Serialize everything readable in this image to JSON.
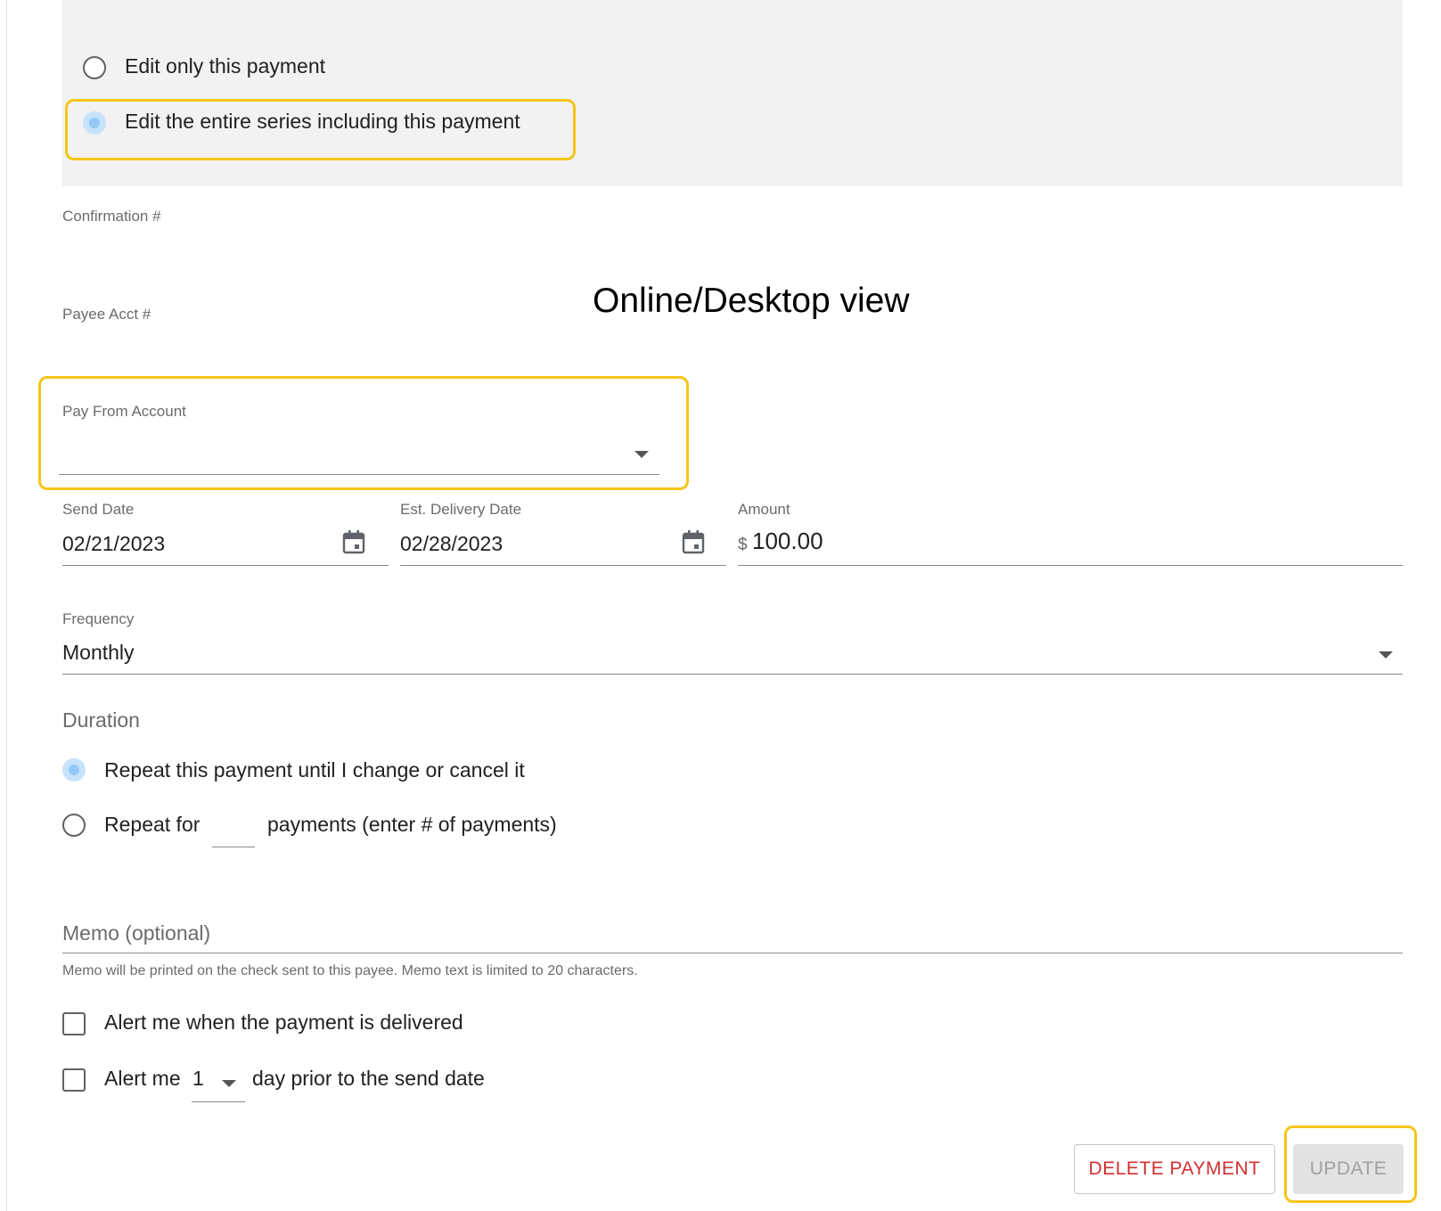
{
  "edit_scope": {
    "option_single": "Edit only this payment",
    "option_series": "Edit the entire series including this payment",
    "selected": "series"
  },
  "fields": {
    "confirmation_label": "Confirmation #",
    "payee_acct_label": "Payee Acct #",
    "pay_from_label": "Pay From Account",
    "send_date_label": "Send Date",
    "send_date_value": "02/21/2023",
    "delivery_date_label": "Est. Delivery Date",
    "delivery_date_value": "02/28/2023",
    "amount_label": "Amount",
    "amount_currency": "$",
    "amount_value": "100.00",
    "frequency_label": "Frequency",
    "frequency_value": "Monthly"
  },
  "duration": {
    "heading": "Duration",
    "option_until_cancel": "Repeat this payment until I change or cancel it",
    "option_repeat_for": "Repeat for",
    "option_repeat_suffix": "payments (enter # of payments)",
    "selected": "until_cancel"
  },
  "memo": {
    "placeholder": "Memo (optional)",
    "helper": "Memo will be printed on the check sent to this payee. Memo text is limited to 20 characters."
  },
  "alerts": {
    "delivered_label": "Alert me when the payment is delivered",
    "prior_prefix": "Alert me",
    "prior_days_value": "1",
    "prior_suffix": "day prior to the send date"
  },
  "actions": {
    "delete_label": "DELETE PAYMENT",
    "update_label": "UPDATE"
  },
  "annotation": {
    "view_label": "Online/Desktop view"
  },
  "colors": {
    "highlight": "#f5c518",
    "delete_text": "#d32f2f",
    "radio_selected": "#93c8f6",
    "panel_bg": "#f2f2f2"
  }
}
